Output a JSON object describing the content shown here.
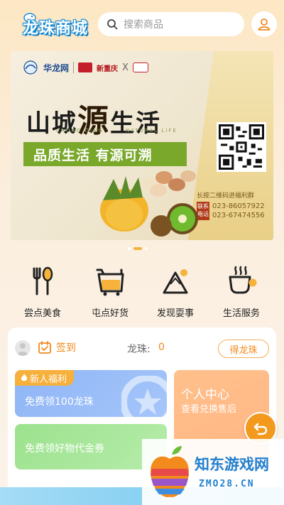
{
  "header": {
    "logo_text": "龙珠商城",
    "search_placeholder": "搜索商品"
  },
  "banner": {
    "brand1": "华龙网",
    "brand2": "新重庆",
    "times": "X",
    "title_pre": "山城",
    "title_big": "源",
    "title_post": "生活",
    "sub_en_left": "CHONG QING",
    "sub_en_right": "NATURAL LIFE",
    "slogan": "品质生活  有源可溯",
    "qr_caption": "长按二维码进福利群",
    "contact_label": "联系电话",
    "phone1": "023-86057922",
    "phone2": "023-67474556"
  },
  "carousel": {
    "count": 3,
    "active_index": 1
  },
  "nav": [
    {
      "label": "尝点美食",
      "icon": "fork-spoon-icon"
    },
    {
      "label": "屯点好货",
      "icon": "cart-icon"
    },
    {
      "label": "发现耍事",
      "icon": "mountain-icon"
    },
    {
      "label": "生活服务",
      "icon": "coffee-cup-icon"
    }
  ],
  "panel": {
    "signin_label": "签到",
    "coin_label": "龙珠:",
    "coin_value": "0",
    "get_coin_label": "得龙珠",
    "welfare_tag": "新人福利",
    "welfare_text": "免费领100龙珠",
    "voucher_text": "免费领好物代金券",
    "personal_title": "个人中心",
    "personal_sub": "查看兑换售后"
  },
  "watermark": {
    "site": "知东游戏网",
    "url": "ZMO28.CN"
  },
  "colors": {
    "accent": "#f08a1c",
    "slogan_green": "#79a82a",
    "welfare_blue": "#8fb5f5",
    "voucher_green": "#9ce28e",
    "personal_orange": "#ffc08c"
  }
}
